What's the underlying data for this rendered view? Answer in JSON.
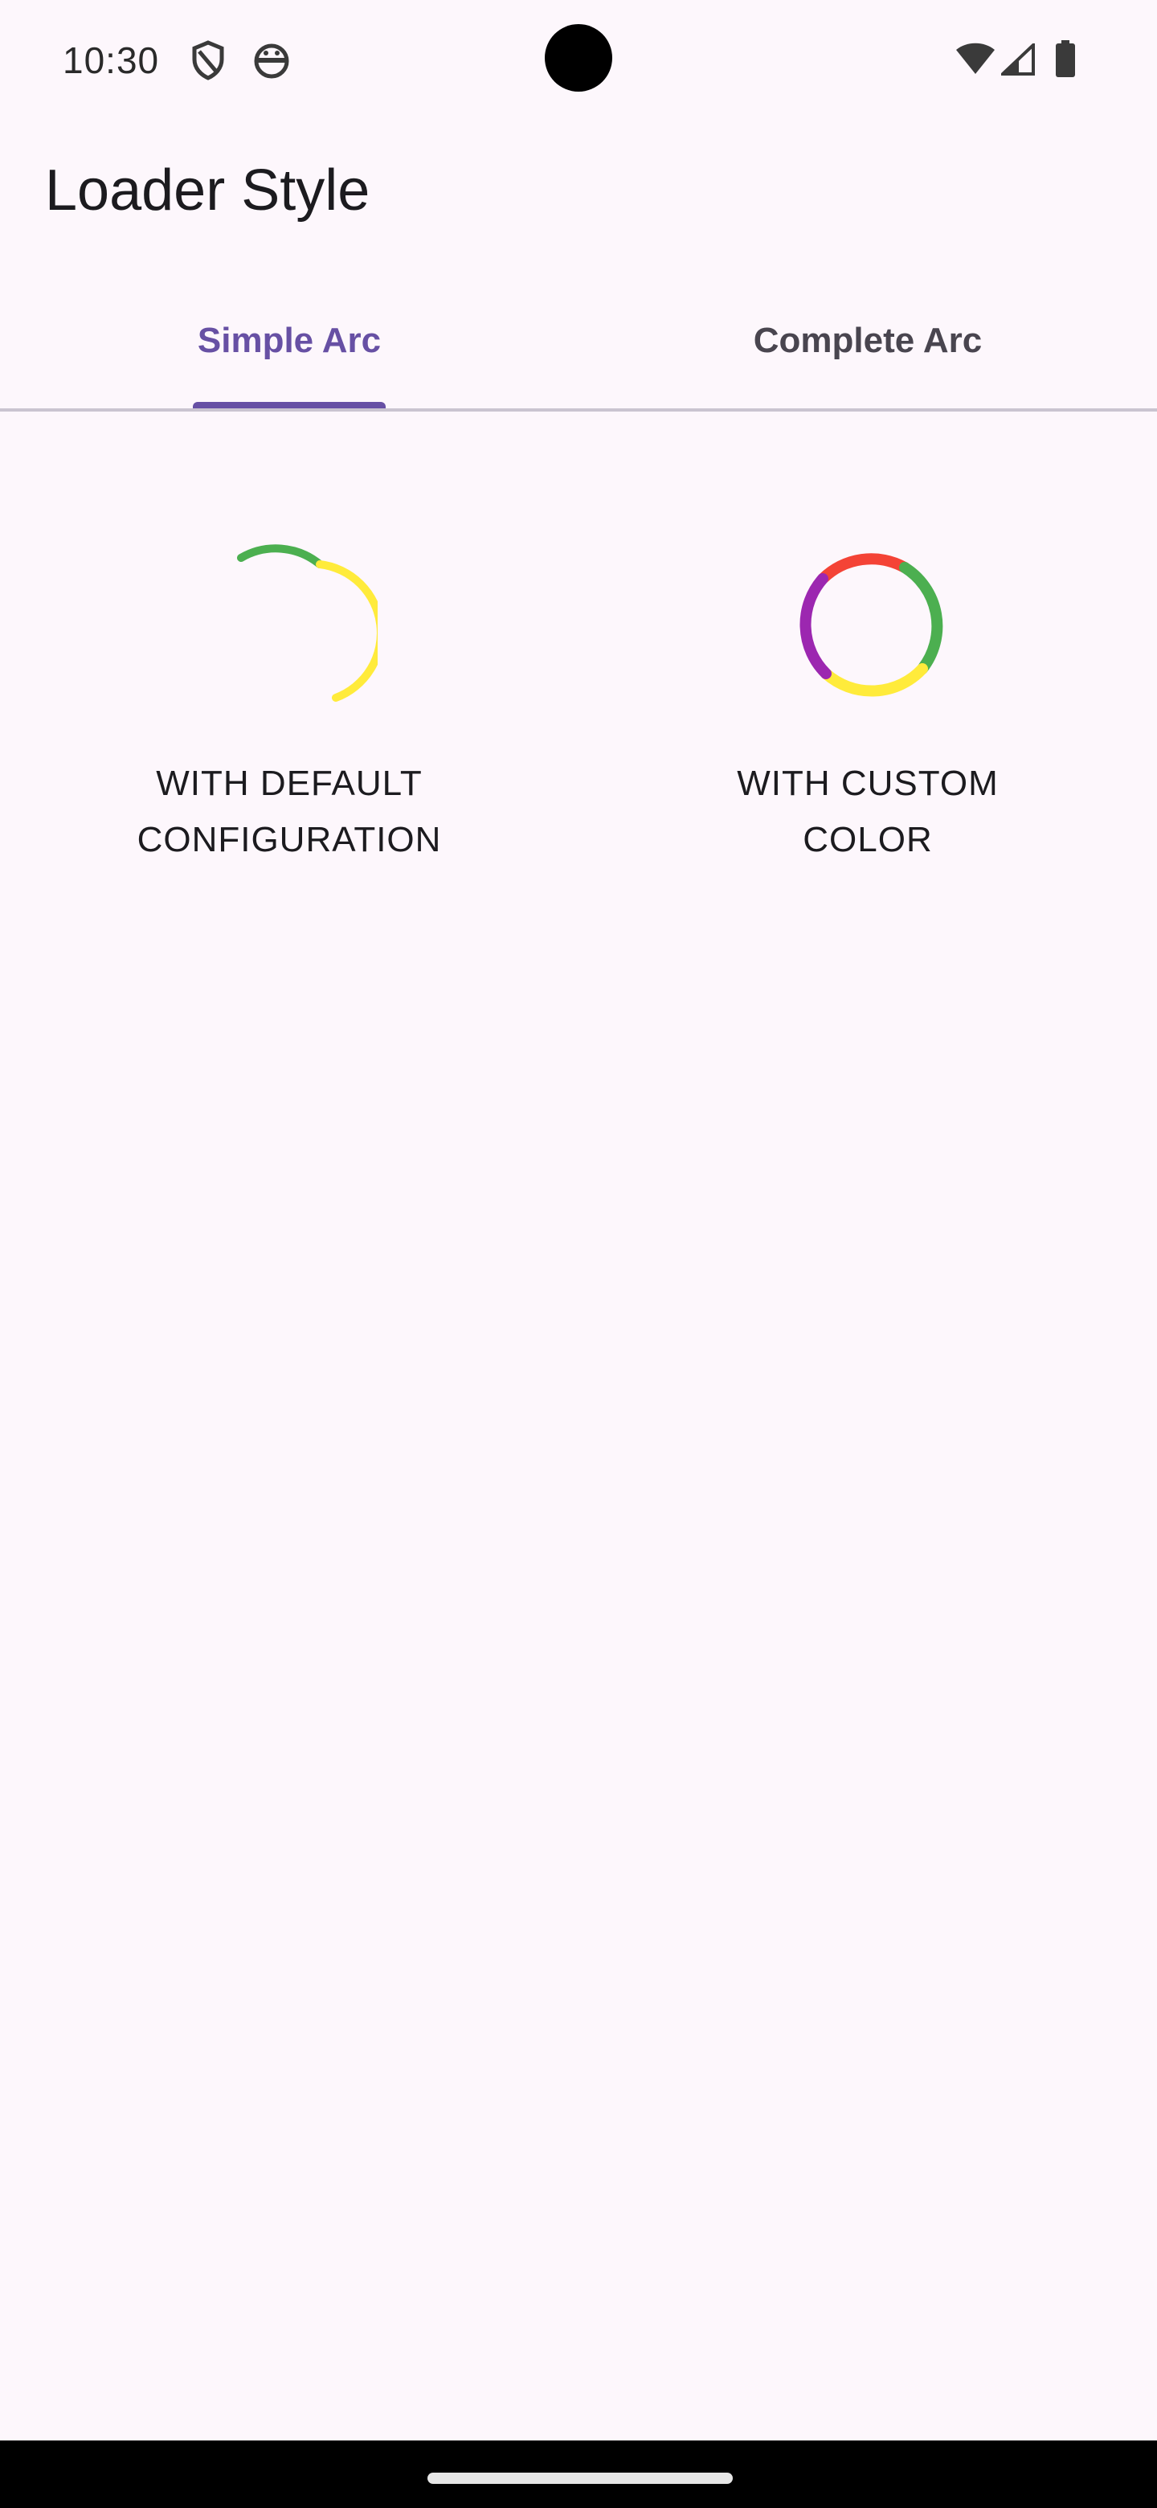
{
  "status_bar": {
    "time": "10:30",
    "left_icons": [
      "shield-icon",
      "android-head-icon"
    ],
    "right_icons": [
      "wifi-icon",
      "cell-signal-icon",
      "battery-icon"
    ]
  },
  "app_bar": {
    "title": "Loader Style"
  },
  "tabs": [
    {
      "label": "Simple Arc",
      "selected": true
    },
    {
      "label": "Complete Arc",
      "selected": false
    }
  ],
  "colors": {
    "accent": "#6750a4",
    "background": "#fdf7fc",
    "green": "#4caf50",
    "yellow": "#ffeb3b",
    "red": "#f44336",
    "purple": "#9c27b0"
  },
  "loaders": [
    {
      "caption_line1": "WITH DEFAULT",
      "caption_line2": "CONFIGURATION"
    },
    {
      "caption_line1": "WITH CUSTOM",
      "caption_line2": "COLOR"
    }
  ]
}
